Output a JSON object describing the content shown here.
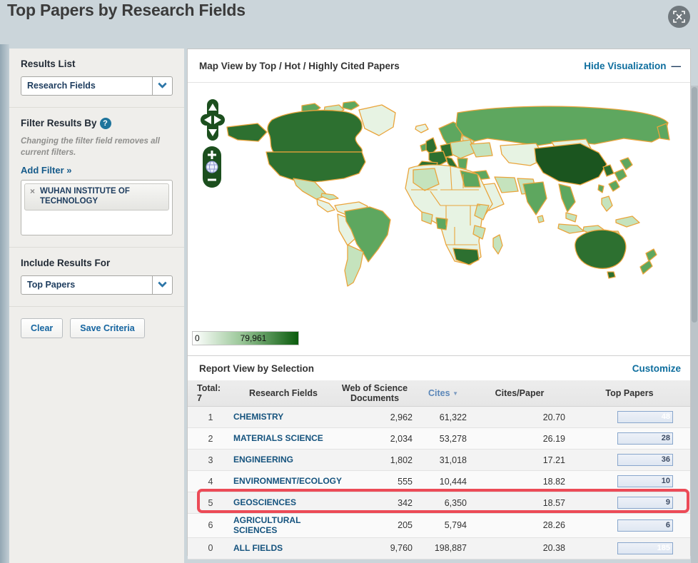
{
  "page": {
    "title": "Top Papers by Research Fields"
  },
  "icons": {
    "help": "?",
    "remove": "×",
    "minus": "—",
    "sort_desc": "▼"
  },
  "colors": {
    "link_blue": "#0e6e9e",
    "bar_blue": "#5585cc",
    "highlight_red": "#ec4b57",
    "map_green_dark": "#1b551f",
    "map_green_light": "#c5e3bd",
    "border_orange": "#eaa43b"
  },
  "sidebar": {
    "results_list": {
      "label": "Results List",
      "selected": "Research Fields"
    },
    "filter": {
      "heading": "Filter Results By",
      "note": "Changing the filter field removes all current filters.",
      "add_filter": "Add Filter »",
      "chip": "WUHAN INSTITUTE OF TECHNOLOGY"
    },
    "include": {
      "label": "Include Results For",
      "selected": "Top Papers"
    },
    "buttons": {
      "clear": "Clear",
      "save": "Save Criteria"
    }
  },
  "map": {
    "title": "Map View by Top / Hot / Highly Cited Papers",
    "hide_link": "Hide Visualization",
    "legend": {
      "min": "0",
      "max": "79,961"
    }
  },
  "report": {
    "title": "Report View by Selection",
    "customize": "Customize",
    "table": {
      "total_label": "Total:",
      "total_value": "7",
      "columns": {
        "field": "Research Fields",
        "docs": "Web of Science Documents",
        "cites": "Cites",
        "cpp": "Cites/Paper",
        "top": "Top Papers"
      },
      "rows": [
        {
          "rank": "1",
          "field": "CHEMISTRY",
          "docs": "2,962",
          "cites": "61,322",
          "cpp": "20.70",
          "top_papers": "48",
          "bar_pct": 100,
          "bar_full": true
        },
        {
          "rank": "2",
          "field": "MATERIALS SCIENCE",
          "docs": "2,034",
          "cites": "53,278",
          "cpp": "26.19",
          "top_papers": "28",
          "bar_pct": 58,
          "bar_full": false
        },
        {
          "rank": "3",
          "field": "ENGINEERING",
          "docs": "1,802",
          "cites": "31,018",
          "cpp": "17.21",
          "top_papers": "36",
          "bar_pct": 75,
          "bar_full": false
        },
        {
          "rank": "4",
          "field": "ENVIRONMENT/ECOLOGY",
          "docs": "555",
          "cites": "10,444",
          "cpp": "18.82",
          "top_papers": "10",
          "bar_pct": 21,
          "bar_full": false
        },
        {
          "rank": "5",
          "field": "GEOSCIENCES",
          "docs": "342",
          "cites": "6,350",
          "cpp": "18.57",
          "top_papers": "9",
          "bar_pct": 19,
          "bar_full": false
        },
        {
          "rank": "6",
          "field": "AGRICULTURAL SCIENCES",
          "docs": "205",
          "cites": "5,794",
          "cpp": "28.26",
          "top_papers": "6",
          "bar_pct": 13,
          "bar_full": false
        },
        {
          "rank": "0",
          "field": "ALL FIELDS",
          "docs": "9,760",
          "cites": "198,887",
          "cpp": "20.38",
          "top_papers": "185",
          "bar_pct": 100,
          "bar_full": true
        }
      ]
    }
  }
}
